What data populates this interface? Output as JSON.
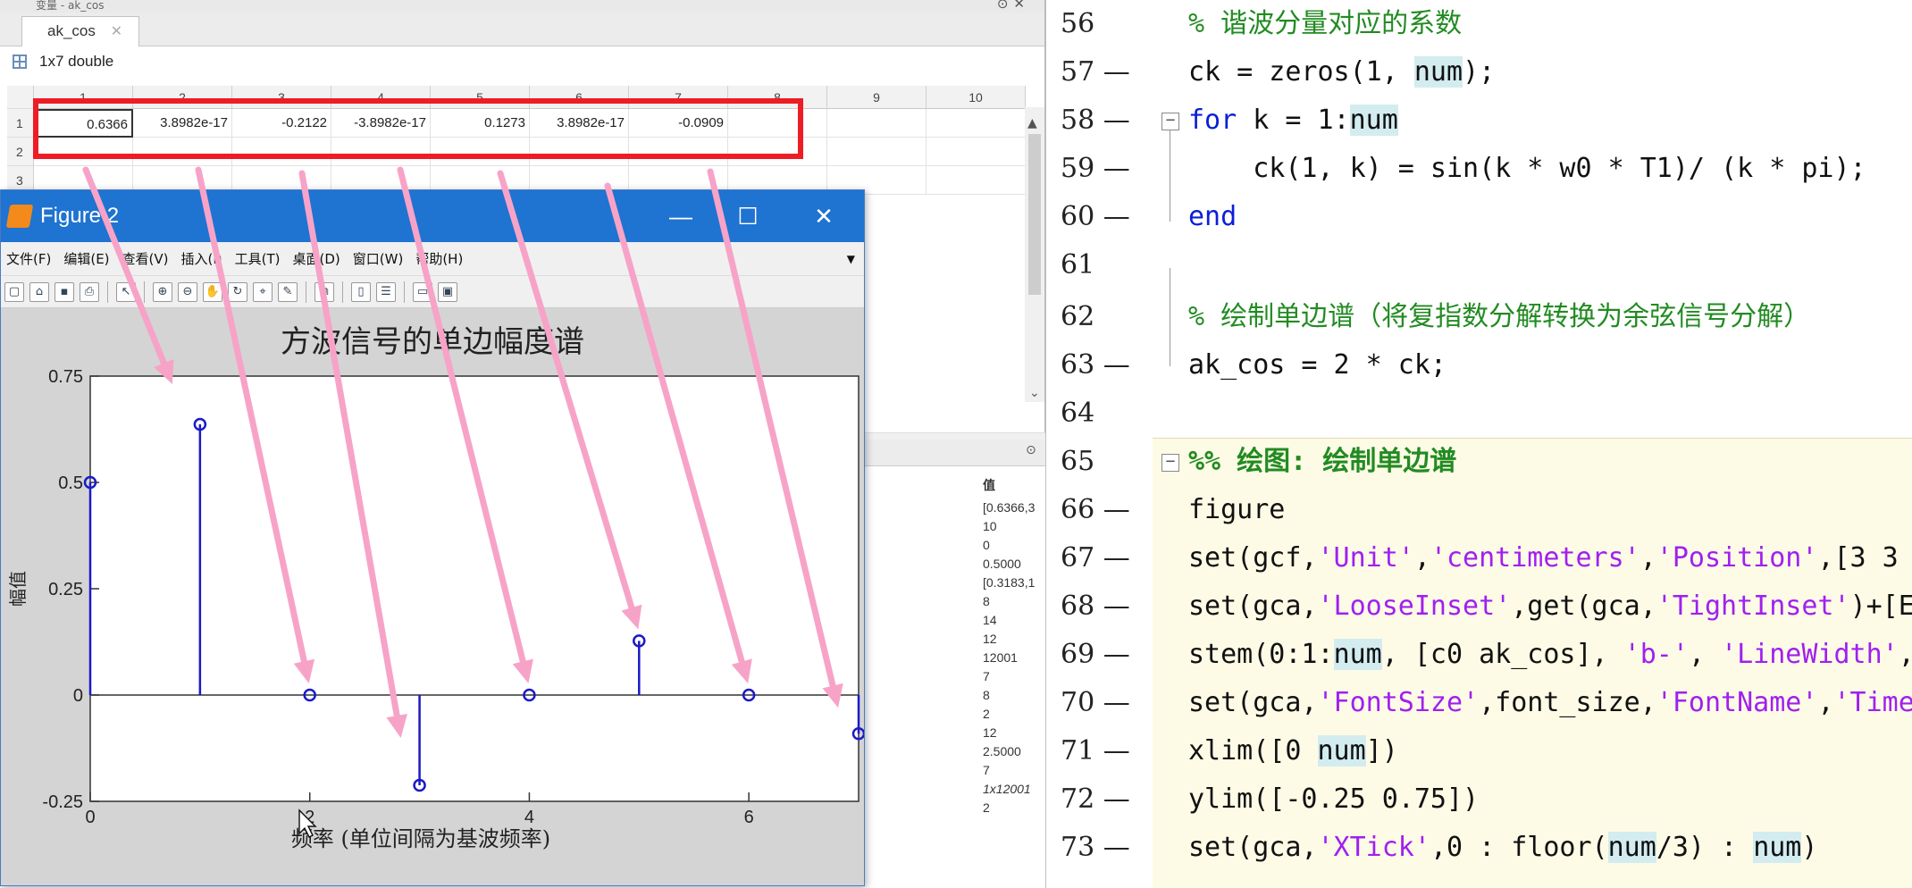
{
  "variable_editor": {
    "title": "变量 - ak_cos",
    "tab_label": "ak_cos",
    "type_label": "1x7 double",
    "column_headers": [
      "1",
      "2",
      "3",
      "4",
      "5",
      "6",
      "7",
      "8",
      "9",
      "10"
    ],
    "row_headers": [
      "1",
      "2",
      "3"
    ],
    "row1": [
      "0.6366",
      "3.8982e-17",
      "-0.2122",
      "-3.8982e-17",
      "0.1273",
      "3.8982e-17",
      "-0.0909",
      "",
      "",
      ""
    ]
  },
  "workspace": {
    "value_header": "值",
    "values": [
      "[0.6366,3",
      "10",
      "0",
      "0.5000",
      "[0.3183,1",
      "8",
      "14",
      "12",
      "12001",
      "7",
      "8",
      "2",
      "12",
      "2.5000",
      "7",
      "1x12001",
      "2"
    ]
  },
  "figure": {
    "title": "Figure 2",
    "menus": [
      "文件(F)",
      "编辑(E)",
      "查看(V)",
      "插入(I)",
      "工具(T)",
      "桌面(D)",
      "窗口(W)",
      "帮助(H)"
    ],
    "minimize": "—",
    "maximize": "☐",
    "close": "✕"
  },
  "chart_data": {
    "type": "stem",
    "title": "方波信号的单边幅度谱",
    "xlabel": "频率 (单位间隔为基波频率)",
    "ylabel": "幅值",
    "x": [
      0,
      1,
      2,
      3,
      4,
      5,
      6,
      7
    ],
    "values": [
      0.5,
      0.6366,
      0,
      -0.2122,
      0,
      0.1273,
      0,
      -0.0909
    ],
    "xlim": [
      0,
      7
    ],
    "ylim": [
      -0.25,
      0.75
    ],
    "xticks": [
      0,
      2,
      4,
      6
    ],
    "yticks": [
      -0.25,
      0,
      0.25,
      0.5,
      0.75
    ],
    "ytick_labels": [
      "-0.25",
      "0",
      "0.25",
      "0.5",
      "0.75"
    ],
    "color": "#1a1ac8",
    "annotation_color": "#f7a3c8"
  },
  "code": {
    "line_numbers": [
      "56",
      "57 —",
      "58 —",
      "59 —",
      "60 —",
      "61",
      "62",
      "63 —",
      "64",
      "65",
      "66 —",
      "67 —",
      "68 —",
      "69 —",
      "70 —",
      "71 —",
      "72 —",
      "73 —"
    ],
    "l56": "% 谐波分量对应的系数",
    "l57a": "ck = zeros(1, ",
    "l57b": "num",
    "l57c": ");",
    "l58a": "for",
    "l58b": " k = 1:",
    "l58c": "num",
    "l59": "    ck(1, k) = sin(k * w0 * T1)/ (k * pi);",
    "l60": "end",
    "l62": "% 绘制单边谱（将复指数分解转换为余弦信号分解）",
    "l63": "ak_cos = 2 * ck;",
    "l65a": "%%",
    "l65b": " 绘图: 绘制单边谱",
    "l66": "figure",
    "l67a": "set(gcf,",
    "l67b": "'Unit'",
    "l67c": ",",
    "l67d": "'centimeters'",
    "l67e": ",",
    "l67f": "'Position'",
    "l67g": ",[3 3",
    "l68a": "set(gca,",
    "l68b": "'LooseInset'",
    "l68c": ",get(gca,",
    "l68d": "'TightInset'",
    "l68e": ")+[E",
    "l69a": "stem(0:1:",
    "l69b": "num",
    "l69c": ", [c0 ak_cos], ",
    "l69d": "'b-'",
    "l69e": ", ",
    "l69f": "'LineWidth'",
    "l69g": ",",
    "l70a": "set(gca,",
    "l70b": "'FontSize'",
    "l70c": ",font_size,",
    "l70d": "'FontName'",
    "l70e": ",",
    "l70f": "'Time",
    "l71a": "xlim([0 ",
    "l71b": "num",
    "l71c": "])",
    "l72": "ylim([-0.25 0.75])",
    "l73a": "set(gca,",
    "l73b": "'XTick'",
    "l73c": ",0 : floor(",
    "l73d": "num",
    "l73e": "/3) : ",
    "l73f": "num",
    "l73g": ")"
  }
}
